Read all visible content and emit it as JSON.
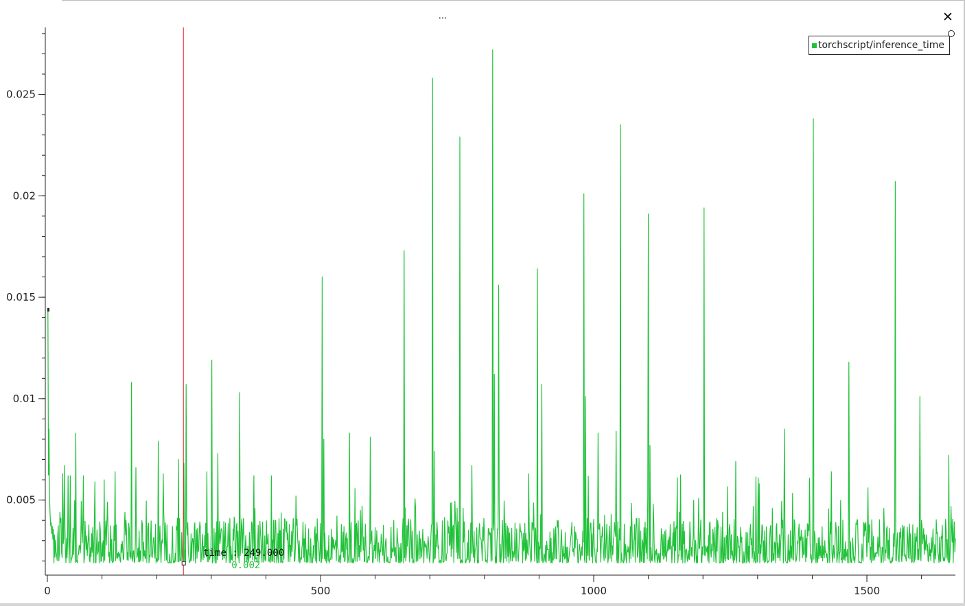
{
  "window": {
    "title": "...",
    "close_label": "✕"
  },
  "legend": {
    "label": "torchscript/inference_time"
  },
  "colors": {
    "series": "#21c23a",
    "cursor": "#e01b24",
    "axis": "#222222"
  },
  "cursor_readout": {
    "x": 249,
    "time_text": "time : 249.000",
    "value_text": "0.002"
  },
  "chart_data": {
    "type": "line",
    "title": "",
    "xlabel": "",
    "ylabel": "",
    "xlim": [
      0,
      1662
    ],
    "ylim": [
      0.0013,
      0.0283
    ],
    "x_ticks": [
      {
        "value": 0,
        "label": "0"
      },
      {
        "value": 500,
        "label": "500"
      },
      {
        "value": 1000,
        "label": "1000"
      },
      {
        "value": 1500,
        "label": "1500"
      }
    ],
    "y_ticks": [
      {
        "value": 0.005,
        "label": "0.005"
      },
      {
        "value": 0.01,
        "label": "0.01"
      },
      {
        "value": 0.015,
        "label": "0.015"
      },
      {
        "value": 0.02,
        "label": "0.02"
      },
      {
        "value": 0.025,
        "label": "0.025"
      }
    ],
    "grid": false,
    "legend_position": "top-right",
    "series": [
      {
        "name": "torchscript/inference_time",
        "baseline": 0.0026,
        "start_value": 0.0144,
        "peaks": [
          [
            1,
            0.0144
          ],
          [
            3,
            0.0085
          ],
          [
            28,
            0.0063
          ],
          [
            31,
            0.0067
          ],
          [
            38,
            0.0062
          ],
          [
            42,
            0.0062
          ],
          [
            52,
            0.0083
          ],
          [
            66,
            0.0062
          ],
          [
            87,
            0.0059
          ],
          [
            104,
            0.006
          ],
          [
            124,
            0.0064
          ],
          [
            154,
            0.0108
          ],
          [
            162,
            0.0066
          ],
          [
            203,
            0.0079
          ],
          [
            212,
            0.0063
          ],
          [
            240,
            0.007
          ],
          [
            250,
            0.0068
          ],
          [
            254,
            0.0107
          ],
          [
            292,
            0.0064
          ],
          [
            301,
            0.0119
          ],
          [
            312,
            0.0073
          ],
          [
            352,
            0.0103
          ],
          [
            378,
            0.0062
          ],
          [
            410,
            0.0062
          ],
          [
            455,
            0.0052
          ],
          [
            503,
            0.016
          ],
          [
            506,
            0.008
          ],
          [
            553,
            0.0083
          ],
          [
            591,
            0.0081
          ],
          [
            653,
            0.0173
          ],
          [
            705,
            0.0258
          ],
          [
            708,
            0.0074
          ],
          [
            755,
            0.0229
          ],
          [
            777,
            0.0067
          ],
          [
            815,
            0.0272
          ],
          [
            818,
            0.0112
          ],
          [
            826,
            0.0156
          ],
          [
            881,
            0.0063
          ],
          [
            897,
            0.0164
          ],
          [
            905,
            0.0107
          ],
          [
            982,
            0.0201
          ],
          [
            985,
            0.0101
          ],
          [
            1008,
            0.0083
          ],
          [
            1041,
            0.0084
          ],
          [
            1049,
            0.0235
          ],
          [
            1100,
            0.0191
          ],
          [
            1103,
            0.0077
          ],
          [
            1153,
            0.0061
          ],
          [
            1202,
            0.0194
          ],
          [
            1260,
            0.0069
          ],
          [
            1301,
            0.0061
          ],
          [
            1349,
            0.0085
          ],
          [
            1402,
            0.0238
          ],
          [
            1435,
            0.0064
          ],
          [
            1467,
            0.0118
          ],
          [
            1502,
            0.0056
          ],
          [
            1552,
            0.0207
          ],
          [
            1597,
            0.0101
          ],
          [
            1650,
            0.0072
          ]
        ]
      }
    ]
  }
}
